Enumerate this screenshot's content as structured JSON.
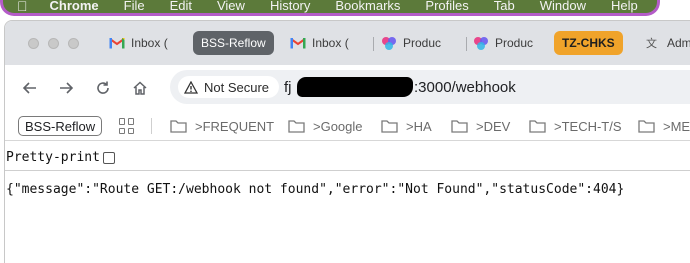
{
  "menubar": {
    "app": "Chrome",
    "items": [
      "File",
      "Edit",
      "View",
      "History",
      "Bookmarks",
      "Profiles",
      "Tab",
      "Window",
      "Help"
    ]
  },
  "tabs": [
    {
      "label": "Inbox (",
      "icon": "gmail-icon"
    },
    {
      "label": "BSS-Reflow",
      "active": true
    },
    {
      "label": "Inbox (",
      "icon": "gmail-icon"
    },
    {
      "label": "Produc",
      "icon": "colorful-logo-icon"
    },
    {
      "label": "Produc",
      "icon": "colorful-logo-icon"
    },
    {
      "label": "TZ-CHKS",
      "group_color": "#f0a32a"
    },
    {
      "label": "Adm",
      "icon": "translate-icon"
    }
  ],
  "toolbar": {
    "security_label": "Not Secure",
    "url_prefix": "fj",
    "url_suffix": ":3000/webhook"
  },
  "bookmarks": {
    "chip": "BSS-Reflow",
    "folders": [
      ">FREQUENT",
      ">Google",
      ">HA",
      ">DEV",
      ">TECH-T/S",
      ">ME"
    ]
  },
  "page": {
    "pretty_print_label": "Pretty-print",
    "pretty_print_checked": false,
    "json_text": "{\"message\":\"Route GET:/webhook not found\",\"error\":\"Not Found\",\"statusCode\":404}"
  },
  "colors": {
    "menubar_bg": "#5c7a3a",
    "menubar_border": "#b45cc8",
    "active_tab": "#5f6368",
    "group_tab": "#f0a32a"
  }
}
